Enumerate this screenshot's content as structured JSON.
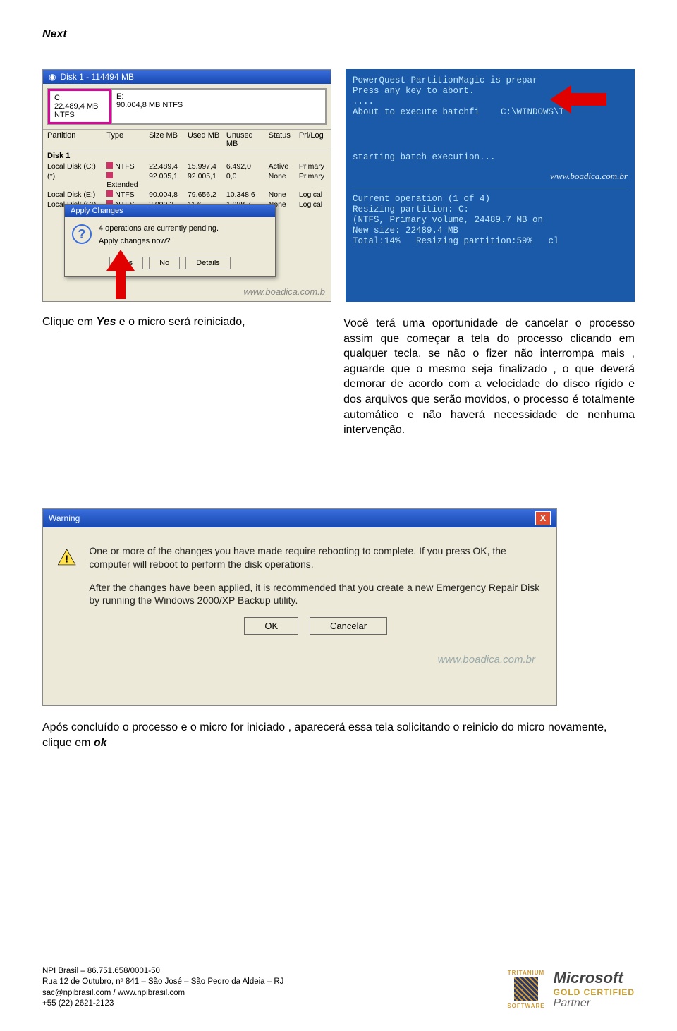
{
  "header": {
    "next": "Next"
  },
  "shot1": {
    "title": "Disk 1 - 114494 MB",
    "partC": "C:\n22.489,4 MB  NTFS",
    "partE": "E:\n90.004,8 MB  NTFS",
    "columns": [
      "Partition",
      "Type",
      "Size MB",
      "Used MB",
      "Unused MB",
      "Status",
      "Pri/Log"
    ],
    "group": "Disk 1",
    "rows": [
      [
        "Local Disk (C:)",
        "NTFS",
        "22.489,4",
        "15.997,4",
        "6.492,0",
        "Active",
        "Primary"
      ],
      [
        "(*)",
        "Extended",
        "92.005,1",
        "92.005,1",
        "0,0",
        "None",
        "Primary"
      ],
      [
        "Local Disk (E:)",
        "NTFS",
        "90.004,8",
        "79.656,2",
        "10.348,6",
        "None",
        "Logical"
      ],
      [
        "Local Disk (G:)",
        "NTFS",
        "2.000,2",
        "11,6",
        "1.988,7",
        "None",
        "Logical"
      ]
    ],
    "dlg_title": "Apply Changes",
    "dlg_line1": "4 operations are currently pending.",
    "dlg_line2": "Apply changes now?",
    "btn_yes": "Yes",
    "btn_no": "No",
    "btn_details": "Details",
    "watermark": "www.boadica.com.b"
  },
  "shot2": {
    "l1": "PowerQuest PartitionMagic is prepar",
    "l2": "Press any key to abort.",
    "l3": "....",
    "l4": "About to execute batchfi    C:\\WINDOWS\\T",
    "l5": "starting batch execution...",
    "wm": "www.boadica.com.br",
    "l6": "Current operation (1 of 4)",
    "l7": "Resizing partition: C:",
    "l8": "(NTFS, Primary volume, 24489.7 MB on",
    "l9": "New size: 22489.4 MB",
    "l10": "Total:14%   Resizing partition:59%   cl"
  },
  "caption": {
    "left_pre": "Clique em ",
    "left_em": "Yes",
    "left_post": " e o micro será reiniciado,",
    "right": "Você terá uma oportunidade de cancelar o processo assim que começar a tela do processo clicando em qualquer tecla, se não o fizer não interrompa mais , aguarde que o mesmo seja finalizado , o que deverá demorar de acordo com a velocidade do disco rígido e dos arquivos que serão movidos, o processo é totalmente automático e não haverá necessidade de nenhuma intervenção."
  },
  "warning": {
    "title": "Warning",
    "p1": "One or more of the changes you have made require rebooting to complete. If you press OK, the computer will reboot to perform the disk operations.",
    "p2": "After the changes have been applied, it is recommended that you create a new Emergency Repair Disk by running the Windows 2000/XP Backup utility.",
    "btn_ok": "OK",
    "btn_cancel": "Cancelar",
    "watermark": "www.boadica.com.br"
  },
  "after": {
    "text_pre": "Após concluído o processo e o micro for iniciado , aparecerá essa tela solicitando o reinicio do micro novamente, clique em ",
    "text_em": "ok"
  },
  "footer": {
    "l1": "NPI Brasil – 86.751.658/0001-50",
    "l2": "Rua 12 de Outubro, nº 841 – São José – São Pedro da Aldeia – RJ",
    "l3": "sac@npibrasil.com / www.npibrasil.com",
    "l4": "+55 (22) 2621-2123",
    "trit": "TRITANIUM",
    "soft": "SOFTWARE",
    "ms": "Microsoft",
    "gold": "GOLD CERTIFIED",
    "partner": "Partner"
  }
}
